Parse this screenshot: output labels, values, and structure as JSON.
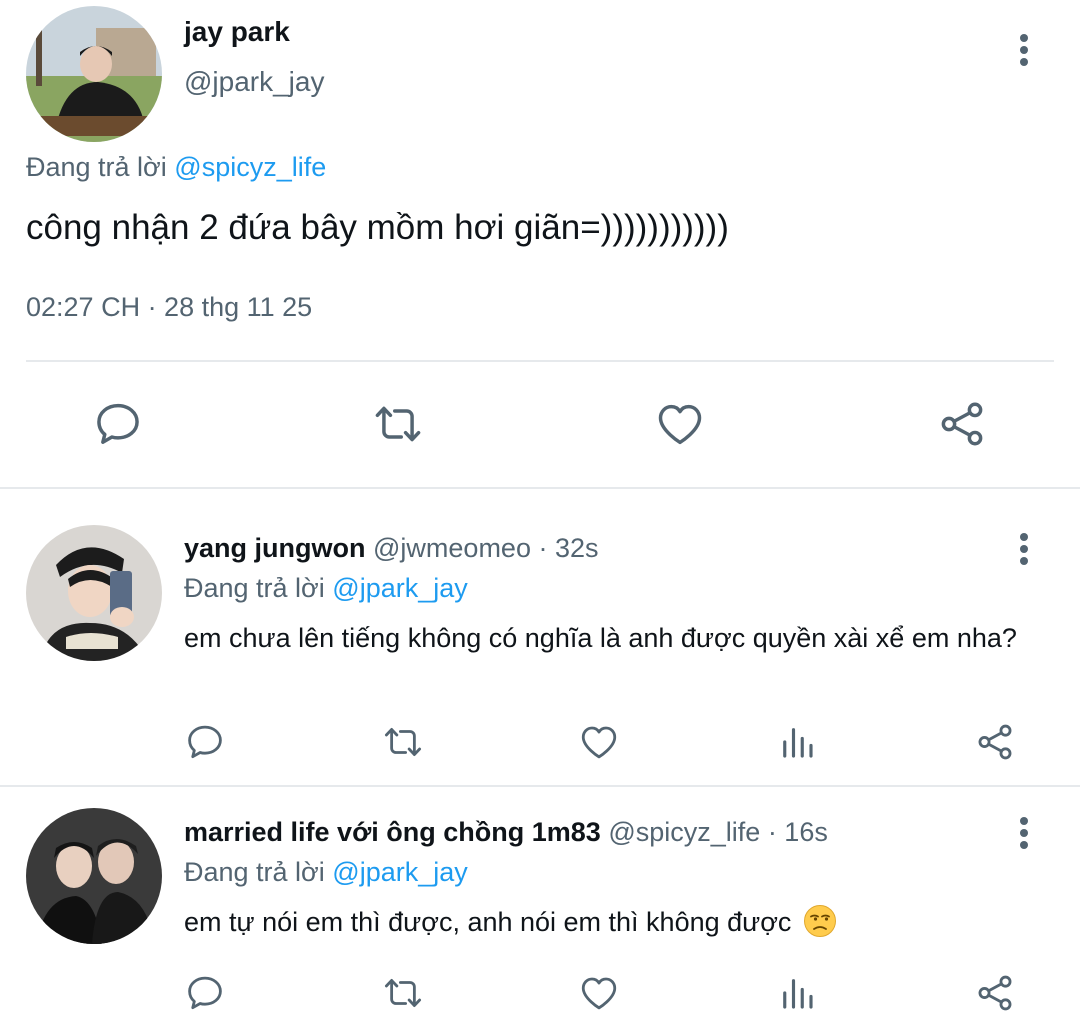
{
  "main_tweet": {
    "author_name": "jay park",
    "author_handle": "@jpark_jay",
    "replying_prefix": "Đang trả lời",
    "replying_to": "@spicyz_life",
    "text": "công nhận 2 đứa bây mồm hơi giãn=)))))))))))",
    "timestamp": "02:27 CH · 28 thg 11 25",
    "actions": [
      "reply-icon",
      "retweet-icon",
      "like-icon",
      "share-icon"
    ]
  },
  "replies": [
    {
      "author_name": "yang jungwon",
      "author_handle": "@jwmeomeo",
      "time": "· 32s",
      "replying_prefix": "Đang trả lời",
      "replying_to": "@jpark_jay",
      "text": "em chưa lên tiếng không có nghĩa là anh được quyền xài xể em nha?",
      "actions": [
        "reply-icon",
        "retweet-icon",
        "like-icon",
        "analytics-icon",
        "share-icon"
      ]
    },
    {
      "author_name": "married life với ông chồng 1m83",
      "author_handle": "@spicyz_life",
      "time": "· 16s",
      "replying_prefix": "Đang trả lời",
      "replying_to": "@jpark_jay",
      "text": "em tự nói em thì được, anh nói em thì không được",
      "emoji": "unamused-face-emoji",
      "actions": [
        "reply-icon",
        "retweet-icon",
        "like-icon",
        "analytics-icon",
        "share-icon"
      ]
    }
  ],
  "colors": {
    "text": "#0f1419",
    "secondary": "#536471",
    "link": "#1d9bf0",
    "divider": "#e6e9ec"
  }
}
